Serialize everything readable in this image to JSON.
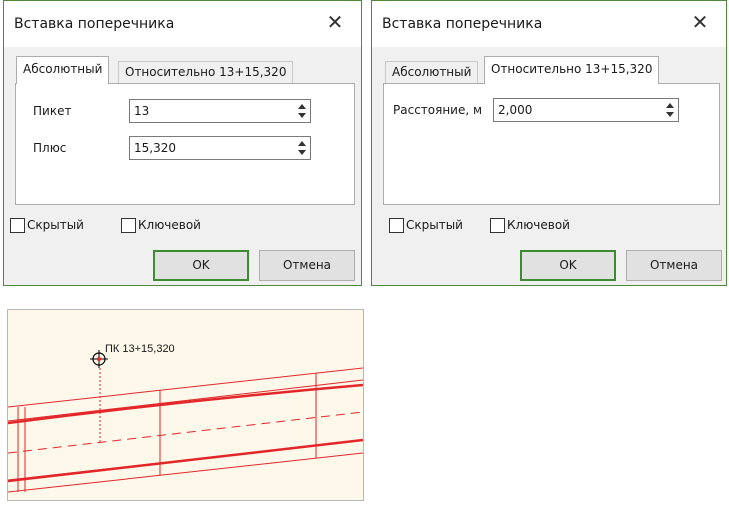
{
  "dialog_left": {
    "title": "Вставка поперечника",
    "close_glyph": "✕",
    "tabs": [
      {
        "label": "Абсолютный",
        "active": true
      },
      {
        "label": "Относительно 13+15,320",
        "active": false
      }
    ],
    "fields": [
      {
        "label": "Пикет",
        "value": "13"
      },
      {
        "label": "Плюс",
        "value": "15,320"
      }
    ],
    "checkboxes": [
      {
        "label": "Скрытый",
        "checked": false
      },
      {
        "label": "Ключевой",
        "checked": false
      }
    ],
    "ok_label": "OK",
    "cancel_label": "Отмена"
  },
  "dialog_right": {
    "title": "Вставка поперечника",
    "close_glyph": "✕",
    "tabs": [
      {
        "label": "Абсолютный",
        "active": false
      },
      {
        "label": "Относительно 13+15,320",
        "active": true
      }
    ],
    "fields": [
      {
        "label": "Расстояние, м",
        "value": "2,000"
      }
    ],
    "checkboxes": [
      {
        "label": "Скрытый",
        "checked": false
      },
      {
        "label": "Ключевой",
        "checked": false
      }
    ],
    "ok_label": "OK",
    "cancel_label": "Отмена"
  },
  "map": {
    "station_label": "ПК 13+15,320",
    "colors": {
      "background": "#fdf8ea",
      "axis_line": "#e3262a",
      "thin_line": "#e3262a",
      "marker": "#000000"
    }
  }
}
